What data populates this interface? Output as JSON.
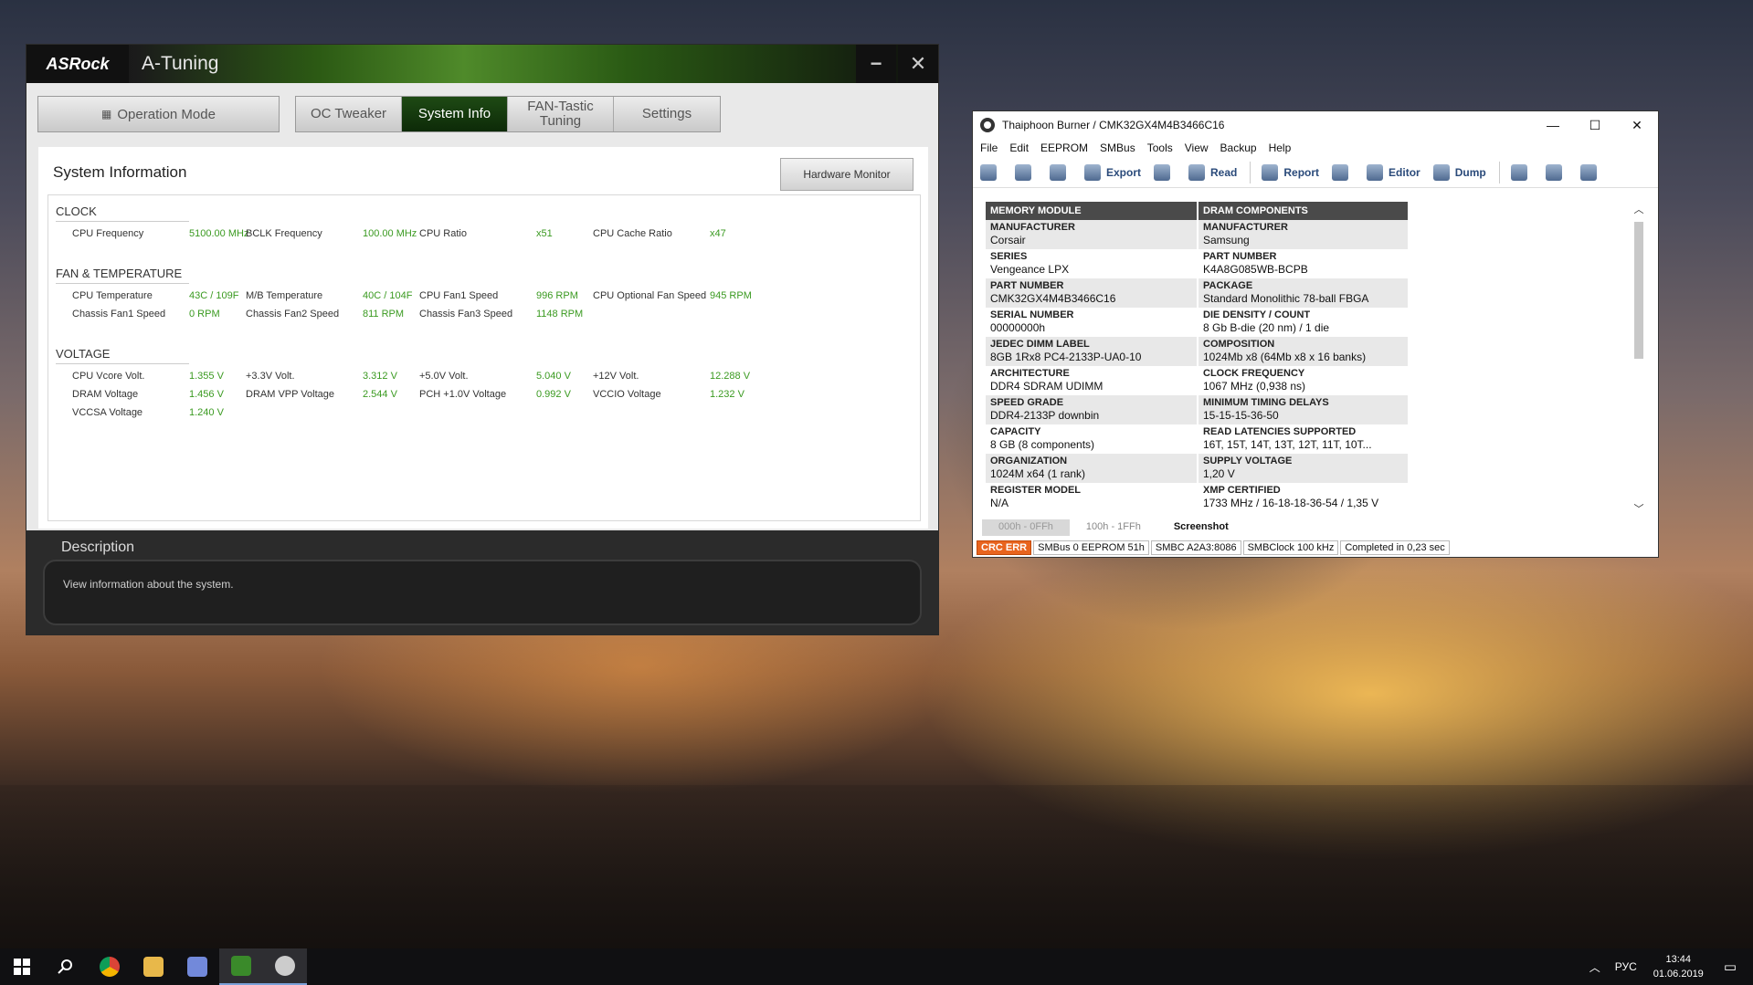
{
  "atuning": {
    "logo": "ASRock",
    "title": "A-Tuning",
    "minimize": "−",
    "close": "✕",
    "operation_mode": "Operation Mode",
    "tabs": [
      {
        "label": "OC Tweaker"
      },
      {
        "label": "System Info"
      },
      {
        "label": "FAN-Tastic Tuning"
      },
      {
        "label": "Settings"
      }
    ],
    "content_title": "System Information",
    "hardware_monitor": "Hardware Monitor",
    "sections": {
      "clock": "CLOCK",
      "fan": "FAN & TEMPERATURE",
      "voltage": "VOLTAGE"
    },
    "clock": [
      {
        "label": "CPU Frequency",
        "value": "5100.00 MHz"
      },
      {
        "label": "BCLK Frequency",
        "value": "100.00 MHz"
      },
      {
        "label": "CPU Ratio",
        "value": "x51"
      },
      {
        "label": "CPU Cache Ratio",
        "value": "x47"
      }
    ],
    "fan": [
      {
        "label": "CPU Temperature",
        "value": "43C / 109F"
      },
      {
        "label": "M/B Temperature",
        "value": "40C / 104F"
      },
      {
        "label": "CPU Fan1 Speed",
        "value": "996 RPM"
      },
      {
        "label": "CPU Optional Fan Speed",
        "value": "945 RPM"
      },
      {
        "label": "Chassis Fan1 Speed",
        "value": "0 RPM"
      },
      {
        "label": "Chassis Fan2 Speed",
        "value": "811 RPM"
      },
      {
        "label": "Chassis Fan3 Speed",
        "value": "1148 RPM"
      }
    ],
    "voltage": [
      {
        "label": "CPU Vcore Volt.",
        "value": "1.355 V"
      },
      {
        "label": "+3.3V Volt.",
        "value": "3.312 V"
      },
      {
        "label": "+5.0V Volt.",
        "value": "5.040 V"
      },
      {
        "label": "+12V Volt.",
        "value": "12.288 V"
      },
      {
        "label": "DRAM Voltage",
        "value": "1.456 V"
      },
      {
        "label": "DRAM VPP Voltage",
        "value": "2.544 V"
      },
      {
        "label": "PCH +1.0V Voltage",
        "value": "0.992 V"
      },
      {
        "label": "VCCIO Voltage",
        "value": "1.232 V"
      },
      {
        "label": "VCCSA Voltage",
        "value": "1.240 V"
      }
    ],
    "description_title": "Description",
    "description_text": "View information about the system."
  },
  "thaiphoon": {
    "title": "Thaiphoon Burner / CMK32GX4M4B3466C16",
    "controls": [
      "—",
      "☐",
      "✕"
    ],
    "menu": [
      "File",
      "Edit",
      "EEPROM",
      "SMBus",
      "Tools",
      "View",
      "Backup",
      "Help"
    ],
    "toolbar": {
      "export": "Export",
      "read": "Read",
      "report": "Report",
      "editor": "Editor",
      "dump": "Dump"
    },
    "col1_header": "MEMORY MODULE",
    "col2_header": "DRAM COMPONENTS",
    "col1": [
      {
        "label": "MANUFACTURER",
        "value": "Corsair"
      },
      {
        "label": "SERIES",
        "value": "Vengeance LPX"
      },
      {
        "label": "PART NUMBER",
        "value": "CMK32GX4M4B3466C16"
      },
      {
        "label": "SERIAL NUMBER",
        "value": "00000000h"
      },
      {
        "label": "JEDEC DIMM LABEL",
        "value": "8GB 1Rx8 PC4-2133P-UA0-10"
      },
      {
        "label": "ARCHITECTURE",
        "value": "DDR4 SDRAM UDIMM"
      },
      {
        "label": "SPEED GRADE",
        "value": "DDR4-2133P downbin"
      },
      {
        "label": "CAPACITY",
        "value": "8 GB (8 components)"
      },
      {
        "label": "ORGANIZATION",
        "value": "1024M x64 (1 rank)"
      },
      {
        "label": "REGISTER MODEL",
        "value": "N/A"
      }
    ],
    "col2": [
      {
        "label": "MANUFACTURER",
        "value": "Samsung"
      },
      {
        "label": "PART NUMBER",
        "value": "K4A8G085WB-BCPB"
      },
      {
        "label": "PACKAGE",
        "value": "Standard Monolithic 78-ball FBGA"
      },
      {
        "label": "DIE DENSITY / COUNT",
        "value": "8 Gb B-die (20 nm) / 1 die"
      },
      {
        "label": "COMPOSITION",
        "value": "1024Mb x8 (64Mb x8 x 16 banks)"
      },
      {
        "label": "CLOCK FREQUENCY",
        "value": "1067 MHz (0,938 ns)"
      },
      {
        "label": "MINIMUM TIMING DELAYS",
        "value": "15-15-15-36-50"
      },
      {
        "label": "READ LATENCIES SUPPORTED",
        "value": "16T, 15T, 14T, 13T, 12T, 11T, 10T..."
      },
      {
        "label": "SUPPLY VOLTAGE",
        "value": "1,20 V"
      },
      {
        "label": "XMP CERTIFIED",
        "value": "1733 MHz / 16-18-18-36-54 / 1,35 V"
      }
    ],
    "bottom_tabs": [
      "000h - 0FFh",
      "100h - 1FFh",
      "Screenshot"
    ],
    "status": [
      "CRC ERR",
      "SMBus 0 EEPROM 51h",
      "SMBC A2A3:8086",
      "SMBClock 100 kHz",
      "Completed in 0,23 sec"
    ]
  },
  "taskbar": {
    "lang": "РУС",
    "time": "13:44",
    "date": "01.06.2019"
  }
}
